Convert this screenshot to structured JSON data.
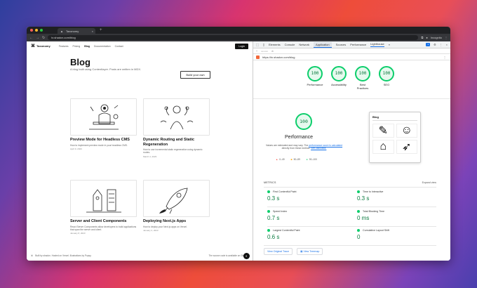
{
  "browser": {
    "tab_title": "Taxonomy",
    "url": "tx.shadcn.com/blog",
    "profile_label": "Incognito"
  },
  "site": {
    "brand": "Taxonomy",
    "nav": [
      "Features",
      "Pricing",
      "Blog",
      "Documentation",
      "Contact"
    ],
    "login_label": "Login",
    "title": "Blog",
    "subtitle": "A blog built using Contentlayer. Posts are written in MDX.",
    "build_button": "Build your own",
    "posts": [
      {
        "title": "Preview Mode for Headless CMS",
        "desc": "How to implement preview mode in your headless CMS.",
        "date": "April 9, 2023"
      },
      {
        "title": "Dynamic Routing and Static Regeneration",
        "desc": "How to use incremental static regeneration using dynamic routes.",
        "date": "March 4, 2023"
      },
      {
        "title": "Server and Client Components",
        "desc": "React Server Components allow developers to build applications that span the server and client.",
        "date": "January 8, 2023"
      },
      {
        "title": "Deploying Next.js Apps",
        "desc": "How to deploy your Next.js apps on Vercel.",
        "date": "January 2, 2023"
      }
    ],
    "footer_left": "Built by shadcn. Hosted on Vercel. Illustrations by Popsy.",
    "footer_right": "The source code is available on GitHub."
  },
  "devtools": {
    "tabs": [
      "Elements",
      "Console",
      "Network",
      "Application",
      "Sources",
      "Performance",
      "Lighthouse"
    ],
    "issues_badge": "1",
    "report_url": "https://tx.shadcn.com/blog",
    "gauges": [
      {
        "label": "Performance",
        "score": "100"
      },
      {
        "label": "Accessibility",
        "score": "100"
      },
      {
        "label": "Best Practices",
        "score": "100"
      },
      {
        "label": "SEO",
        "score": "100"
      }
    ],
    "perf_score": "100",
    "perf_title": "Performance",
    "perf_desc_1": "Values are estimated and may vary. The ",
    "perf_desc_link1": "performance score is calculated",
    "perf_desc_2": " directly from these metrics. ",
    "perf_desc_link2": "See calculator.",
    "legend": [
      "0–49",
      "50–89",
      "90–100"
    ],
    "metrics_heading": "METRICS",
    "expand_label": "Expand view",
    "metrics": [
      {
        "name": "First Contentful Paint",
        "value": "0.3 s"
      },
      {
        "name": "Time to Interactive",
        "value": "0.3 s"
      },
      {
        "name": "Speed Index",
        "value": "0.7 s"
      },
      {
        "name": "Total Blocking Time",
        "value": "0 ms"
      },
      {
        "name": "Largest Contentful Paint",
        "value": "0.6 s"
      },
      {
        "name": "Cumulative Layout Shift",
        "value": "0"
      }
    ],
    "view_trace": "View Original Trace",
    "view_treemap": "View Treemap",
    "thumb_title": "Blog"
  }
}
